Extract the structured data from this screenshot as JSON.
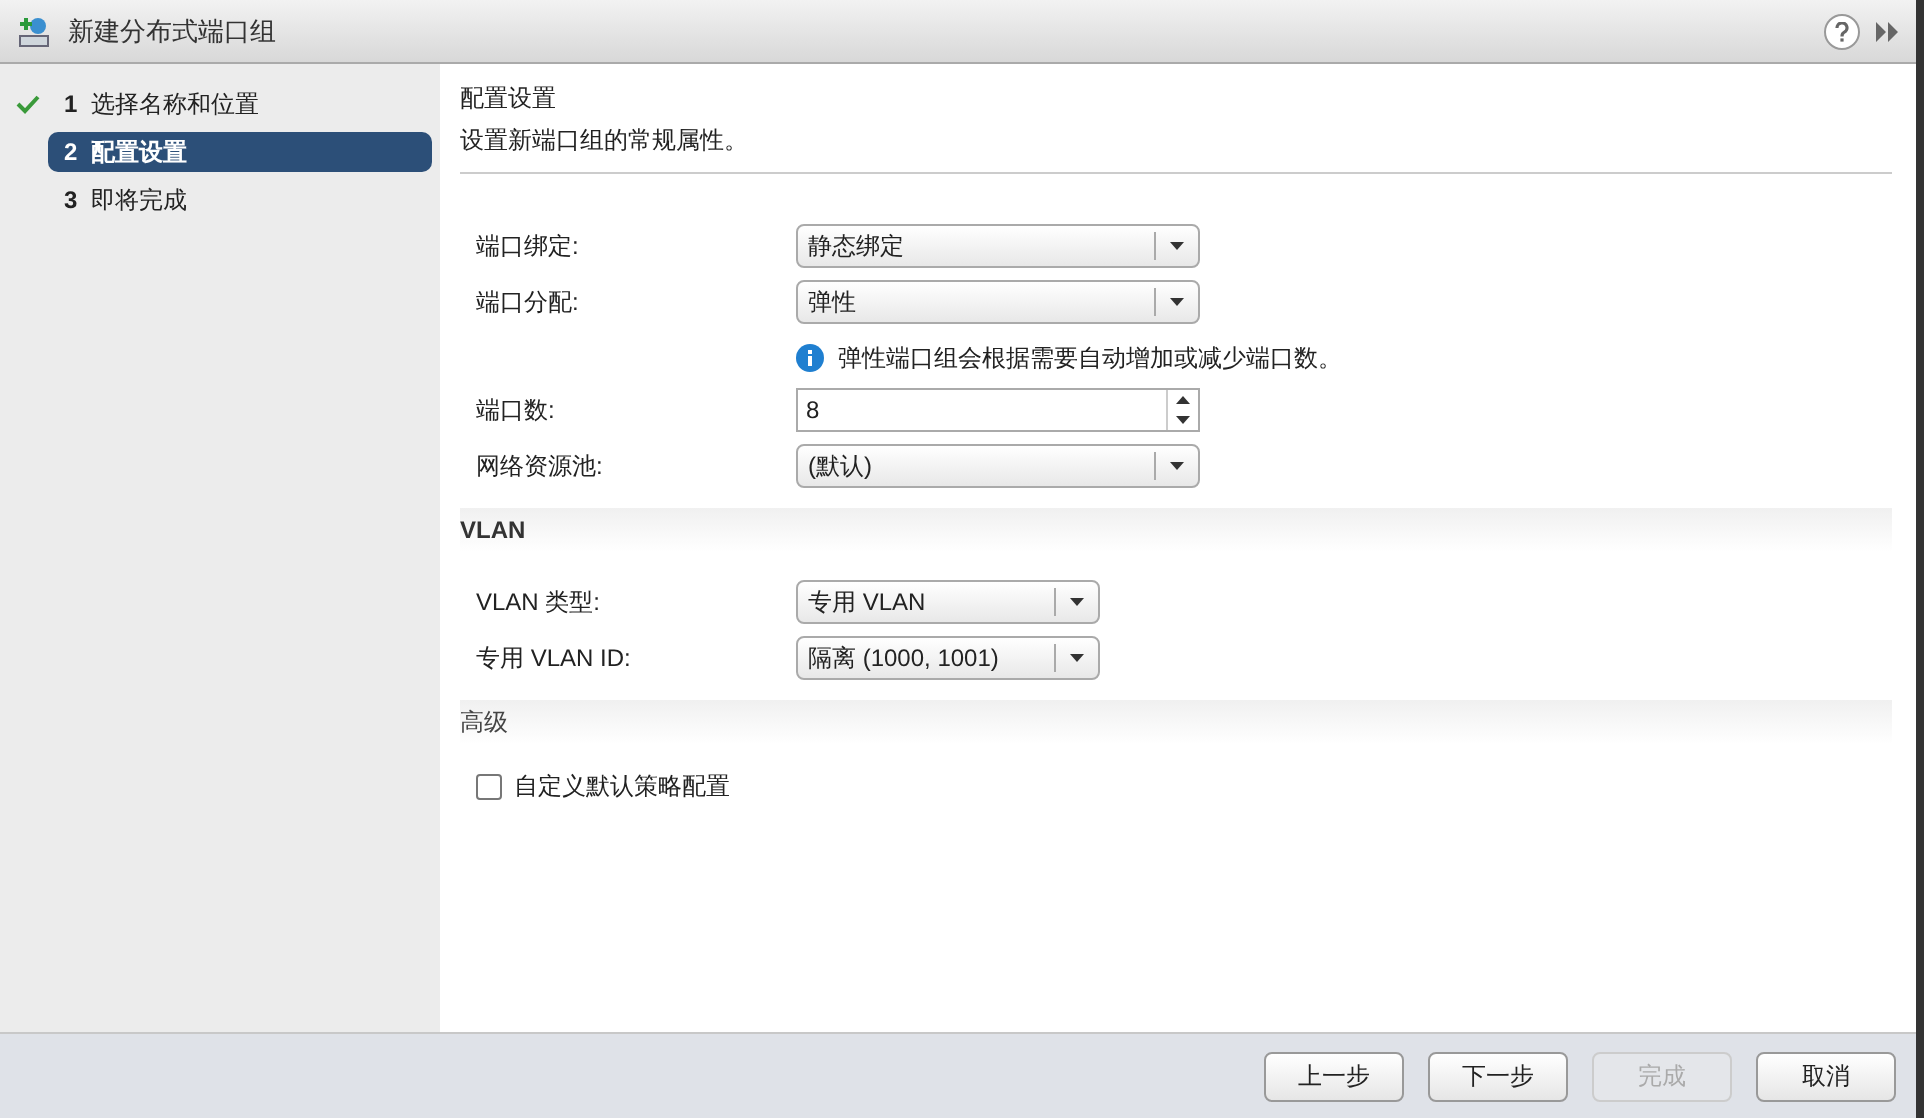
{
  "window": {
    "title": "新建分布式端口组"
  },
  "steps": [
    {
      "number": "1",
      "label": "选择名称和位置",
      "done": true,
      "selected": false
    },
    {
      "number": "2",
      "label": "配置设置",
      "done": false,
      "selected": true
    },
    {
      "number": "3",
      "label": "即将完成",
      "done": false,
      "selected": false
    }
  ],
  "header": {
    "title": "配置设置",
    "subtitle": "设置新端口组的常规属性。"
  },
  "sections": [
    {
      "fields": [
        {
          "kind": "select",
          "label": "端口绑定:",
          "value": "静态绑定"
        },
        {
          "kind": "select",
          "label": "端口分配:",
          "value": "弹性",
          "note": "弹性端口组会根据需要自动增加或减少端口数。"
        },
        {
          "kind": "spinner",
          "label": "端口数:",
          "value": "8"
        },
        {
          "kind": "select",
          "label": "网络资源池:",
          "value": "(默认)"
        }
      ]
    },
    {
      "title": "VLAN",
      "fields": [
        {
          "kind": "select",
          "label": "VLAN 类型:",
          "value": "专用 VLAN"
        },
        {
          "kind": "select",
          "label": "专用 VLAN ID:",
          "value": "隔离 (1000, 1001)"
        }
      ]
    },
    {
      "title": "高级",
      "fields": [
        {
          "kind": "checkbox",
          "label": "自定义默认策略配置",
          "checked": false
        }
      ]
    }
  ],
  "buttons": [
    {
      "label": "上一步",
      "disabled": false
    },
    {
      "label": "下一步",
      "disabled": false
    },
    {
      "label": "完成",
      "disabled": true
    },
    {
      "label": "取消",
      "disabled": false
    }
  ]
}
